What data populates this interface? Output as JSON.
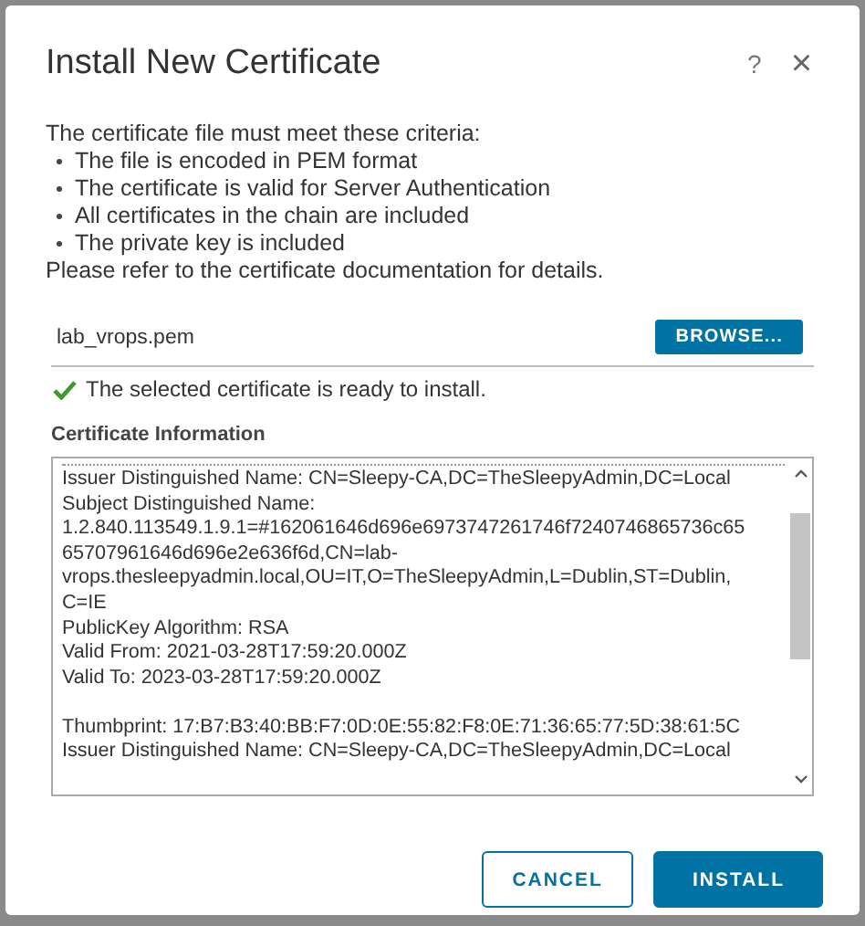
{
  "dialog": {
    "title": "Install New Certificate",
    "help": "?",
    "close": "×"
  },
  "criteria": {
    "intro": "The certificate file must meet these criteria:",
    "items": [
      "The file is encoded in PEM format",
      "The certificate is valid for Server Authentication",
      "All certificates in the chain are included",
      "The private key is included"
    ],
    "note": "Please refer to the certificate documentation for details."
  },
  "file": {
    "value": "lab_vrops.pem",
    "button": "BROWSE..."
  },
  "status": {
    "kind": "success",
    "text": "The selected certificate is ready to install."
  },
  "certificate_information": {
    "label": "Certificate Information",
    "blocks": [
      [
        "Issuer Distinguished Name: CN=Sleepy-CA,DC=TheSleepyAdmin,DC=Local",
        "Subject Distinguished Name:",
        "1.2.840.113549.1.9.1=#162061646d696e6973747261746f7240746865736c65",
        "65707961646d696e2e636f6d,CN=lab-",
        "vrops.thesleepyadmin.local,OU=IT,O=TheSleepyAdmin,L=Dublin,ST=Dublin,",
        "C=IE",
        "PublicKey Algorithm: RSA",
        "Valid From: 2021-03-28T17:59:20.000Z",
        "Valid To: 2023-03-28T17:59:20.000Z"
      ],
      [
        "Thumbprint: 17:B7:B3:40:BB:F7:0D:0E:55:82:F8:0E:71:36:65:77:5D:38:61:5C",
        "Issuer Distinguished Name: CN=Sleepy-CA,DC=TheSleepyAdmin,DC=Local"
      ]
    ]
  },
  "buttons": [
    {
      "label": "CANCEL",
      "kind": "secondary"
    },
    {
      "label": "INSTALL",
      "kind": "primary"
    }
  ]
}
